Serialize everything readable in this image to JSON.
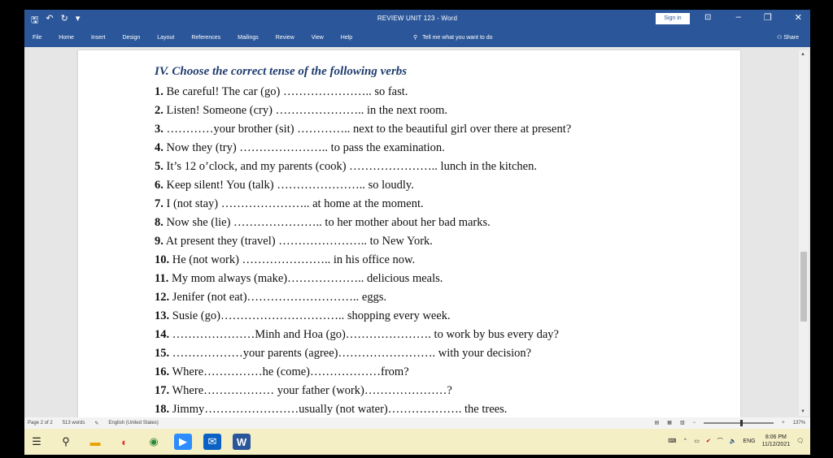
{
  "titlebar": {
    "title": "REVIEW UNIT 123 - Word",
    "signin": "Sign in",
    "minimize": "–",
    "restore": "❐",
    "close": "✕"
  },
  "menu": {
    "items": [
      "File",
      "Home",
      "Insert",
      "Design",
      "Layout",
      "References",
      "Mailings",
      "Review",
      "View",
      "Help"
    ],
    "tellme": "Tell me what you want to do",
    "share": "Share"
  },
  "document": {
    "heading": "IV. Choose the correct tense of the following verbs",
    "exercises": [
      {
        "num": "1.",
        "text": "Be careful! The car (go) ………………….. so fast."
      },
      {
        "num": "2.",
        "text": "Listen! Someone (cry) ………………….. in the next room."
      },
      {
        "num": "3.",
        "text": "…………your brother (sit) ………….. next to the beautiful girl over there at present?"
      },
      {
        "num": "4.",
        "text": "Now they (try) ………………….. to pass the examination."
      },
      {
        "num": "5.",
        "text": "It’s 12 o’clock, and my parents (cook) ………………….. lunch in the kitchen."
      },
      {
        "num": "6.",
        "text": "Keep silent! You (talk) ………………….. so loudly."
      },
      {
        "num": "7.",
        "text": "I (not stay) ………………….. at home at the moment."
      },
      {
        "num": "8.",
        "text": "Now she (lie) ………………….. to her mother about her bad marks."
      },
      {
        "num": "9.",
        "text": "At present they (travel) ………………….. to New York."
      },
      {
        "num": "10.",
        "text": "He (not work) ………………….. in his office now."
      },
      {
        "num": "11.",
        "text": "My mom always (make)……………….. delicious meals."
      },
      {
        "num": "12.",
        "text": "Jenifer (not eat)……………………….. eggs."
      },
      {
        "num": "13.",
        "text": "Susie (go)………………………….. shopping every week."
      },
      {
        "num": "14.",
        "text": "…………………Minh and Hoa (go)…………………. to work by bus every day?"
      },
      {
        "num": "15.",
        "text": "………………your parents (agree)……………………. with your decision?"
      },
      {
        "num": "16.",
        "text": "Where……………he (come)………………from?"
      },
      {
        "num": "17.",
        "text": "Where……………… your father (work)…………………?"
      },
      {
        "num": "18.",
        "text": "Jimmy……………………usually (not water)………………. the trees."
      }
    ]
  },
  "statusbar": {
    "page": "Page 2 of 2",
    "words": "513 words",
    "language": "English (United States)",
    "zoom": "137%",
    "zoom_level": 0.52
  },
  "taskbar": {
    "language": "ENG",
    "time": "8:06 PM",
    "date": "11/12/2021"
  },
  "colors": {
    "word_blue": "#2b579a",
    "taskbar_bg": "#f5efc5"
  }
}
